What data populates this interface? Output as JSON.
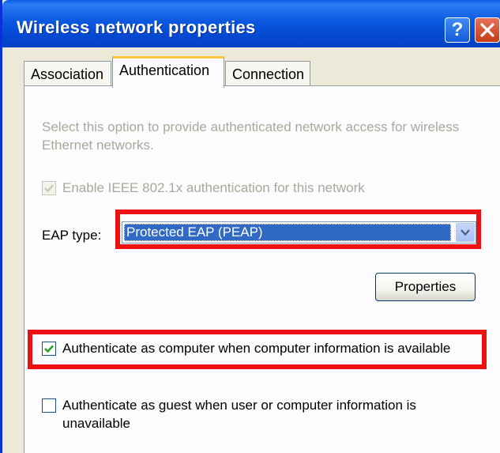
{
  "window": {
    "title": "Wireless network properties",
    "help_glyph": "?"
  },
  "tabs": [
    {
      "label": "Association",
      "selected": false
    },
    {
      "label": "Authentication",
      "selected": true
    },
    {
      "label": "Connection",
      "selected": false
    }
  ],
  "authentication": {
    "description": "Select this option to provide authenticated network access for wireless Ethernet networks.",
    "enable_8021x": {
      "label": "Enable IEEE 802.1x authentication for this network",
      "checked": true,
      "disabled": true
    },
    "eap_type_label": "EAP type:",
    "eap_type_value": "Protected EAP (PEAP)",
    "properties_button": "Properties",
    "auth_as_computer": {
      "label": "Authenticate as computer when computer information is available",
      "checked": true
    },
    "auth_as_guest": {
      "label": "Authenticate as guest when user or computer information is unavailable",
      "checked": false
    }
  },
  "annotations": {
    "highlight_color": "#ee1111"
  },
  "colors": {
    "title_bar": "#0b58e0",
    "selection": "#316ac5",
    "dialog_bg": "#ece9d8",
    "tab_accent": "#ffc83c"
  },
  "icons": [
    "help-icon",
    "close-icon",
    "checkmark-icon",
    "chevron-down-icon"
  ]
}
